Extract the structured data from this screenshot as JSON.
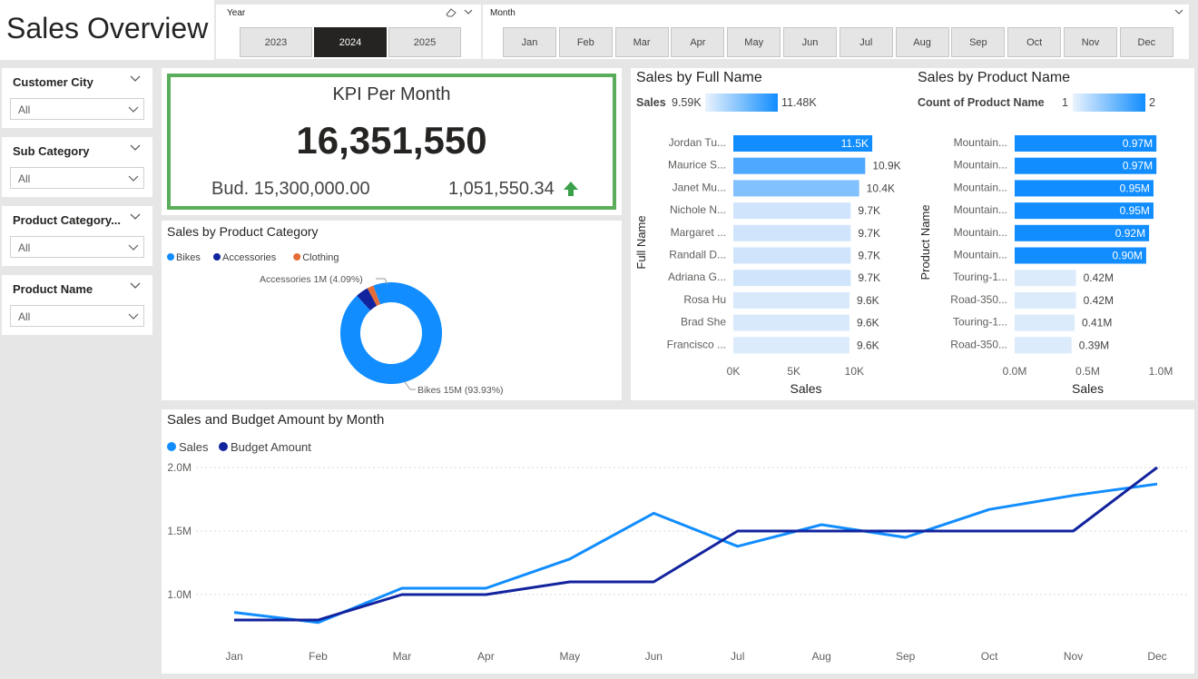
{
  "title": "Sales Overview",
  "year_slicer": {
    "label": "Year",
    "options": [
      "2023",
      "2024",
      "2025"
    ],
    "selected": "2024"
  },
  "month_slicer": {
    "label": "Month",
    "options": [
      "Jan",
      "Feb",
      "Mar",
      "Apr",
      "May",
      "Jun",
      "Jul",
      "Aug",
      "Sep",
      "Oct",
      "Nov",
      "Dec"
    ]
  },
  "filters": [
    {
      "label": "Customer City",
      "value": "All"
    },
    {
      "label": "Sub Category",
      "value": "All"
    },
    {
      "label": "Product Category...",
      "value": "All"
    },
    {
      "label": "Product Name",
      "value": "All"
    }
  ],
  "kpi": {
    "title": "KPI Per Month",
    "value": "16,351,550",
    "budget": "Bud. 15,300,000.00",
    "variance": "1,051,550.34",
    "border_color": "#5aad5a",
    "arrow_color": "#3aa04a"
  },
  "colors": {
    "accent": "#118dff",
    "dark_blue": "#12239e",
    "clothing": "#e66c37",
    "light_bar": "#dcebfb"
  },
  "product_category_chart": {
    "title": "Sales by Product Category",
    "legend": [
      "Bikes",
      "Accessories",
      "Clothing"
    ],
    "label_accessories": "Accessories 1M (4.09%)",
    "label_bikes": "Bikes 15M (93.93%)"
  },
  "full_name_chart": {
    "title": "Sales by Full Name",
    "legend_label": "Sales",
    "legend_min": "9.59K",
    "legend_max": "11.48K",
    "y_axis_title": "Full Name",
    "x_axis_title": "Sales",
    "x_ticks": [
      "0K",
      "5K",
      "10K"
    ]
  },
  "product_name_chart": {
    "title": "Sales by Product Name",
    "legend_label": "Count of Product Name",
    "legend_min": "1",
    "legend_max": "2",
    "y_axis_title": "Product Name",
    "x_axis_title": "Sales",
    "x_ticks": [
      "0.0M",
      "0.5M",
      "1.0M"
    ]
  },
  "line_chart": {
    "title": "Sales and Budget Amount by Month",
    "legend": [
      "Sales",
      "Budget Amount"
    ],
    "y_ticks": [
      "2.0M",
      "1.5M",
      "1.0M"
    ]
  },
  "chart_data": [
    {
      "type": "pie",
      "title": "Sales by Product Category",
      "categories": [
        "Bikes",
        "Accessories",
        "Clothing"
      ],
      "values": [
        93.93,
        4.09,
        1.98
      ],
      "unit": "%",
      "donut": true
    },
    {
      "type": "bar",
      "orientation": "horizontal",
      "title": "Sales by Full Name",
      "xlabel": "Sales",
      "ylabel": "Full Name",
      "xlim": [
        0,
        12000
      ],
      "categories": [
        "Jordan Tu...",
        "Maurice S...",
        "Janet Mu...",
        "Nichole N...",
        "Margaret ...",
        "Randall D...",
        "Adriana G...",
        "Rosa Hu",
        "Brad She",
        "Francisco ..."
      ],
      "values": [
        11480,
        10900,
        10400,
        9700,
        9700,
        9700,
        9700,
        9600,
        9600,
        9600
      ],
      "labels": [
        "11.5K",
        "10.9K",
        "10.4K",
        "9.7K",
        "9.7K",
        "9.7K",
        "9.7K",
        "9.6K",
        "9.6K",
        "9.6K"
      ],
      "color_levels": [
        1.0,
        0.7,
        0.45,
        0.06,
        0.06,
        0.06,
        0.06,
        0.02,
        0.02,
        0.0
      ]
    },
    {
      "type": "bar",
      "orientation": "horizontal",
      "title": "Sales by Product Name",
      "xlabel": "Sales",
      "ylabel": "Product Name",
      "xlim": [
        0,
        1.0
      ],
      "unit": "M",
      "categories": [
        "Mountain...",
        "Mountain...",
        "Mountain...",
        "Mountain...",
        "Mountain...",
        "Mountain...",
        "Touring-1...",
        "Road-350...",
        "Touring-1...",
        "Road-350..."
      ],
      "values": [
        0.97,
        0.97,
        0.95,
        0.95,
        0.92,
        0.9,
        0.42,
        0.42,
        0.41,
        0.39
      ],
      "labels": [
        "0.97M",
        "0.97M",
        "0.95M",
        "0.95M",
        "0.92M",
        "0.90M",
        "0.42M",
        "0.42M",
        "0.41M",
        "0.39M"
      ],
      "counts": [
        2,
        2,
        2,
        2,
        2,
        2,
        1,
        1,
        1,
        1
      ]
    },
    {
      "type": "line",
      "title": "Sales and Budget Amount by Month",
      "x": [
        "Jan",
        "Feb",
        "Mar",
        "Apr",
        "May",
        "Jun",
        "Jul",
        "Aug",
        "Sep",
        "Oct",
        "Nov",
        "Dec"
      ],
      "ylim": [
        0.7,
        2.0
      ],
      "unit": "M",
      "series": [
        {
          "name": "Sales",
          "values": [
            0.86,
            0.78,
            1.05,
            1.05,
            1.28,
            1.64,
            1.38,
            1.55,
            1.45,
            1.67,
            1.78,
            1.87
          ]
        },
        {
          "name": "Budget Amount",
          "values": [
            0.8,
            0.8,
            1.0,
            1.0,
            1.1,
            1.1,
            1.5,
            1.5,
            1.5,
            1.5,
            1.5,
            2.0
          ]
        }
      ],
      "grid": true
    }
  ]
}
